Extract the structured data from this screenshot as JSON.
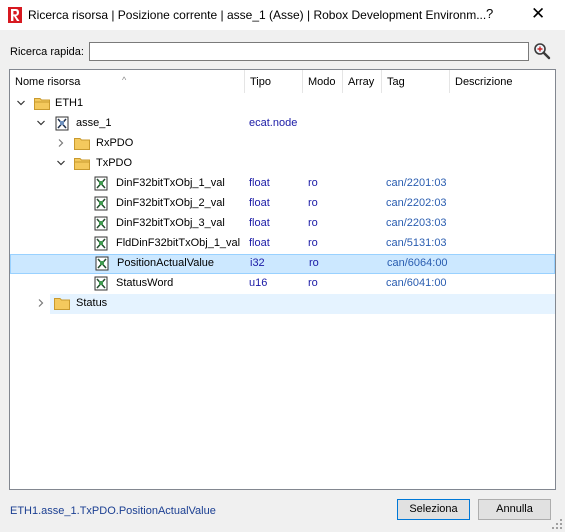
{
  "window": {
    "title": "Ricerca risorsa | Posizione corrente | asse_1 (Asse) | Robox Development Environm...",
    "help": "?",
    "close": "✕"
  },
  "search": {
    "label": "Ricerca rapida:",
    "value": "",
    "placeholder": ""
  },
  "columns": [
    "Nome risorsa",
    "Tipo",
    "Modo",
    "Array",
    "Tag",
    "Descrizione"
  ],
  "tree": {
    "eth1": {
      "name": "ETH1"
    },
    "asse1": {
      "name": "asse_1",
      "tipo": "ecat.node"
    },
    "rxpdo": {
      "name": "RxPDO"
    },
    "txpdo": {
      "name": "TxPDO"
    },
    "items": [
      {
        "name": "DinF32bitTxObj_1_val",
        "tipo": "float",
        "modo": "ro",
        "tag": "can/2201:03"
      },
      {
        "name": "DinF32bitTxObj_2_val",
        "tipo": "float",
        "modo": "ro",
        "tag": "can/2202:03"
      },
      {
        "name": "DinF32bitTxObj_3_val",
        "tipo": "float",
        "modo": "ro",
        "tag": "can/2203:03"
      },
      {
        "name": "FldDinF32bitTxObj_1_val",
        "tipo": "float",
        "modo": "ro",
        "tag": "can/5131:03"
      },
      {
        "name": "PositionActualValue",
        "tipo": "i32",
        "modo": "ro",
        "tag": "can/6064:00"
      },
      {
        "name": "StatusWord",
        "tipo": "u16",
        "modo": "ro",
        "tag": "can/6041:00"
      }
    ],
    "status": {
      "name": "Status"
    }
  },
  "footer": {
    "path": "ETH1.asse_1.TxPDO.PositionActualValue",
    "select_label": "Seleziona",
    "cancel_label": "Annulla"
  }
}
